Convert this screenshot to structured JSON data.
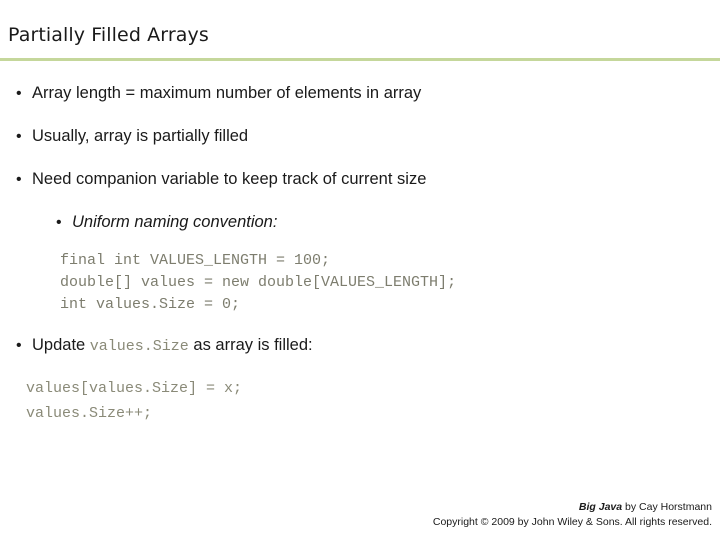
{
  "slide": {
    "title": "Partially Filled Arrays",
    "accent_color": "#c5d79b",
    "code_color": "#8a8a78",
    "bullets": [
      {
        "level": 1,
        "text": "Array length = maximum number of elements in array"
      },
      {
        "level": 1,
        "text": "Usually, array is partially filled"
      },
      {
        "level": 1,
        "text": "Need companion variable to keep track of current size"
      },
      {
        "level": 2,
        "text": "Uniform naming convention:"
      }
    ],
    "code_block_1": "final int VALUES_LENGTH = 100;\ndouble[] values = new double[VALUES_LENGTH];\nint values.Size = 0;",
    "update_bullet": {
      "prefix": "Update ",
      "code": "values.Size",
      "suffix": " as array is filled:"
    },
    "code_block_2": "values[values.Size] = x;\nvalues.Size++;"
  },
  "footer": {
    "book": "Big Java",
    "byline": " by Cay Horstmann",
    "copyright": "Copyright © 2009 by John Wiley & Sons.  All rights reserved."
  }
}
